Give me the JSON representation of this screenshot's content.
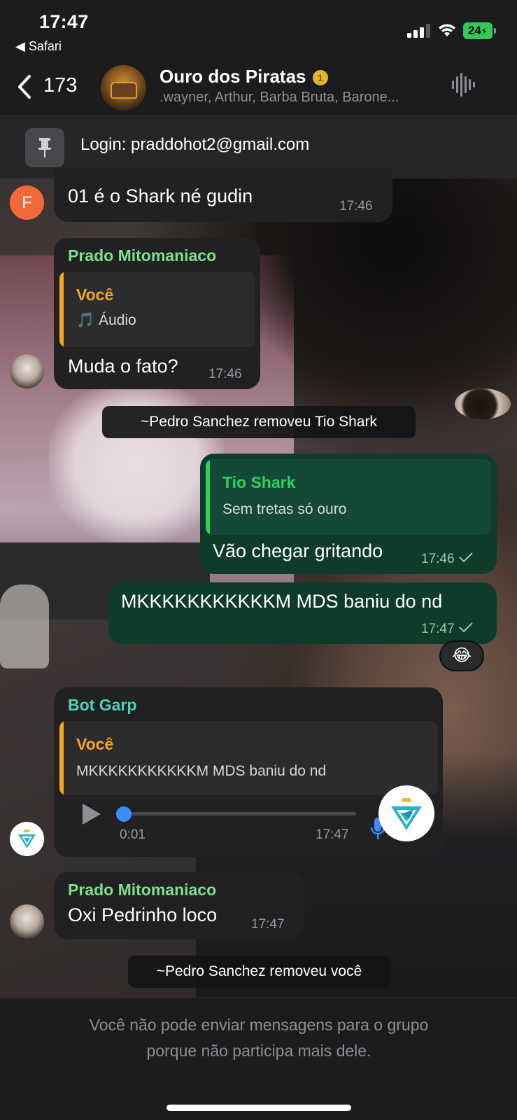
{
  "status_bar": {
    "time": "17:47",
    "back_app": "◀ Safari",
    "battery": "24"
  },
  "header": {
    "back_count": "173",
    "title": "Ouro dos Piratas",
    "title_emoji": "1",
    "members": ".wayner, Arthur, Barba Bruta, Barone..."
  },
  "pinned": {
    "text": "Login: praddohot2@gmail.com"
  },
  "messages": [
    {
      "avatar_letter": "F",
      "text": "01 é o Shark né gudin",
      "time": "17:46"
    },
    {
      "sender": "Prado Mitomaniaco",
      "reply_name": "Você",
      "reply_text": "🎵 Áudio",
      "text": "Muda o fato?",
      "time": "17:46"
    },
    {
      "system": "~Pedro Sanchez removeu Tio Shark"
    },
    {
      "reply_name": "Tio Shark",
      "reply_text": "Sem tretas só ouro",
      "text": "Vão chegar gritando",
      "time": "17:46"
    },
    {
      "text": "MKKKKKKKKKKKM MDS baniu do nd",
      "time": "17:47",
      "reaction": "😂"
    },
    {
      "sender": "Bot Garp",
      "reply_name": "Você",
      "reply_text": "MKKKKKKKKKKKM MDS baniu do nd",
      "audio_elapsed": "0:01",
      "time": "17:47",
      "audio_progress": 0.0
    },
    {
      "sender": "Prado Mitomaniaco",
      "text": "Oxi Pedrinho loco",
      "time": "17:47"
    },
    {
      "system": "~Pedro Sanchez removeu você"
    }
  ],
  "footer": {
    "line1": "Você não pode enviar mensagens para o grupo",
    "line2": "porque não participa mais dele."
  },
  "colors": {
    "outgoing_bubble": "#0f3b2b",
    "incoming_bubble": "#212123",
    "sender_green": "#7ee08a",
    "sender_teal": "#4fd0b8",
    "reply_orange": "#f5a623",
    "reply_green": "#30d158",
    "audio_blue": "#3a8dff"
  }
}
